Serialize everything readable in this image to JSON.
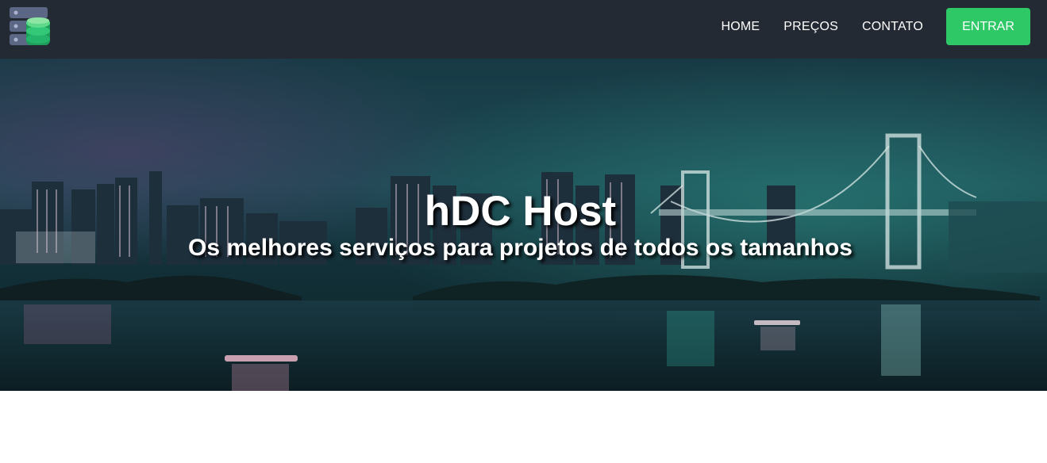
{
  "navbar": {
    "logo_icon": "server-database-icon",
    "links": [
      {
        "label": "HOME"
      },
      {
        "label": "PREÇOS"
      },
      {
        "label": "CONTATO"
      }
    ],
    "login_label": "ENTRAR"
  },
  "hero": {
    "title": "hDC Host",
    "subtitle": "Os melhores serviços para projetos de todos os tamanhos"
  },
  "colors": {
    "navbar_bg": "#242a33",
    "accent_green": "#2ec866",
    "hero_teal": "#1b4a53"
  }
}
